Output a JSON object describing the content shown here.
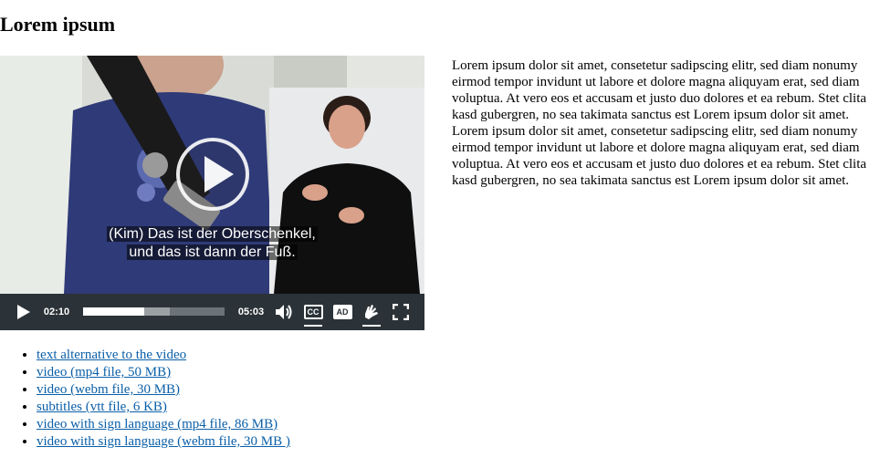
{
  "page": {
    "title": "Lorem ipsum"
  },
  "player": {
    "subtitle_line1": "(Kim) Das ist der Oberschenkel,",
    "subtitle_line2": "und das ist dann der Fuß.",
    "current_time": "02:10",
    "duration": "05:03",
    "progress_played": 0.43,
    "progress_buffered": 0.61,
    "cc_label": "CC",
    "ad_label": "AD",
    "icons": {
      "big_play": "play-circle-icon",
      "play": "play-icon",
      "volume": "volume-icon",
      "sign_language": "sign-language-icon",
      "fullscreen": "fullscreen-icon"
    }
  },
  "article": {
    "text": "Lorem ipsum dolor sit amet, consetetur sadipscing elitr, sed diam nonumy eirmod tempor invidunt ut labore et dolore magna aliquyam erat, sed diam voluptua. At vero eos et accusam et justo duo dolores et ea rebum. Stet clita kasd gubergren, no sea takimata sanctus est Lorem ipsum dolor sit amet. Lorem ipsum dolor sit amet, consetetur sadipscing elitr, sed diam nonumy eirmod tempor invidunt ut labore et dolore magna aliquyam erat, sed diam voluptua. At vero eos et accusam et justo duo dolores et ea rebum. Stet clita kasd gubergren, no sea takimata sanctus est Lorem ipsum dolor sit amet."
  },
  "downloads": [
    {
      "label": "text alternative to the video"
    },
    {
      "label": "video (mp4 file, 50 MB)"
    },
    {
      "label": "video (webm file, 30 MB)"
    },
    {
      "label": "subtitles (vtt file, 6 KB)"
    },
    {
      "label": "video with sign language (mp4 file, 86 MB)"
    },
    {
      "label": "video with sign language (webm file, 30 MB )"
    }
  ],
  "colors": {
    "link": "#0b5fa8",
    "control_bar": "#2b3338"
  }
}
